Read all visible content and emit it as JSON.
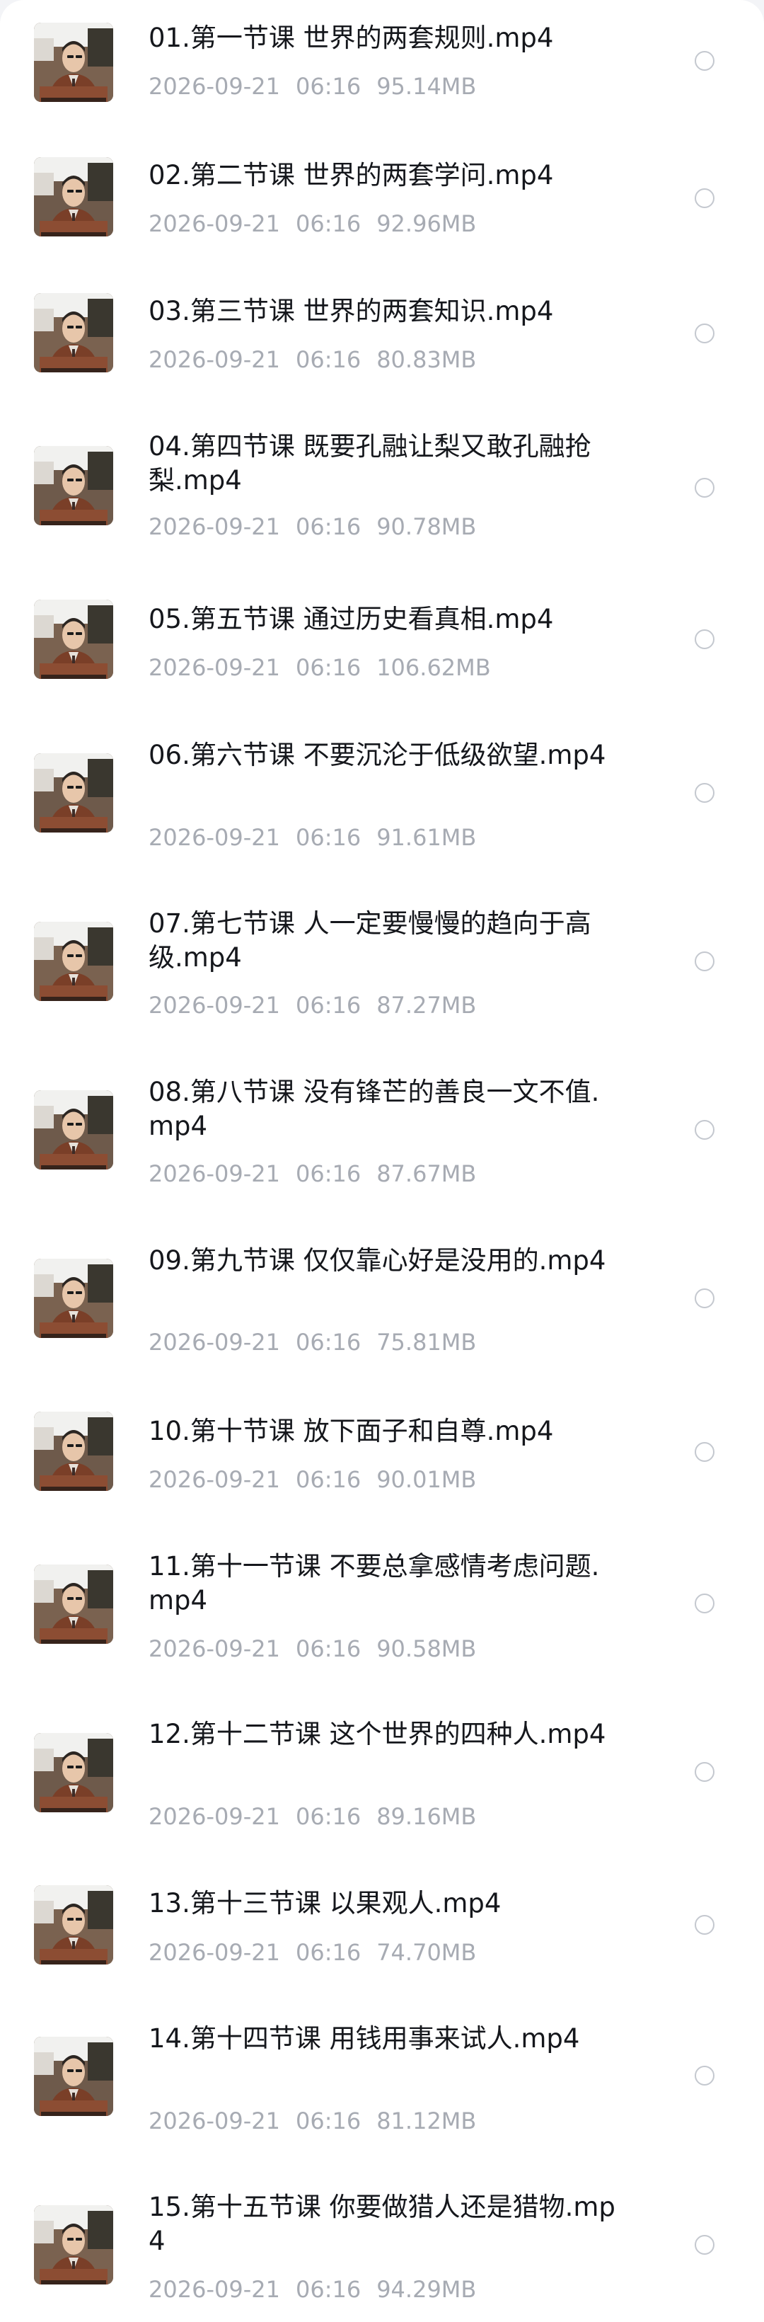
{
  "files": [
    {
      "title": "01.第一节课 世界的两套规则.mp4",
      "date": "2026-09-21",
      "time": "06:16",
      "size": "95.14MB"
    },
    {
      "title": "02.第二节课 世界的两套学问.mp4",
      "date": "2026-09-21",
      "time": "06:16",
      "size": "92.96MB"
    },
    {
      "title": "03.第三节课 世界的两套知识.mp4",
      "date": "2026-09-21",
      "time": "06:16",
      "size": "80.83MB"
    },
    {
      "title": "04.第四节课 既要孔融让梨又敢孔融抢梨.mp4",
      "date": "2026-09-21",
      "time": "06:16",
      "size": "90.78MB"
    },
    {
      "title": "05.第五节课  通过历史看真相.mp4",
      "date": "2026-09-21",
      "time": "06:16",
      "size": "106.62MB"
    },
    {
      "title": "06.第六节课  不要沉沦于低级欲望.mp4",
      "date": "2026-09-21",
      "time": "06:16",
      "size": "91.61MB"
    },
    {
      "title": "07.第七节课  人一定要慢慢的趋向于高级.mp4",
      "date": "2026-09-21",
      "time": "06:16",
      "size": "87.27MB"
    },
    {
      "title": "08.第八节课 没有锋芒的善良一文不值.mp4",
      "date": "2026-09-21",
      "time": "06:16",
      "size": "87.67MB"
    },
    {
      "title": "09.第九节课 仅仅靠心好是没用的.mp4",
      "date": "2026-09-21",
      "time": "06:16",
      "size": "75.81MB"
    },
    {
      "title": "10.第十节课 放下面子和自尊.mp4",
      "date": "2026-09-21",
      "time": "06:16",
      "size": "90.01MB"
    },
    {
      "title": "11.第十一节课  不要总拿感情考虑问题.mp4",
      "date": "2026-09-21",
      "time": "06:16",
      "size": "90.58MB"
    },
    {
      "title": "12.第十二节课 这个世界的四种人.mp4",
      "date": "2026-09-21",
      "time": "06:16",
      "size": "89.16MB"
    },
    {
      "title": "13.第十三节课  以果观人.mp4",
      "date": "2026-09-21",
      "time": "06:16",
      "size": "74.70MB"
    },
    {
      "title": "14.第十四节课 用钱用事来试人.mp4",
      "date": "2026-09-21",
      "time": "06:16",
      "size": "81.12MB"
    },
    {
      "title": "15.第十五节课 你要做猎人还是猎物.mp4",
      "date": "2026-09-21",
      "time": "06:16",
      "size": "94.29MB"
    }
  ],
  "colors": {
    "title": "#15171c",
    "meta": "#a7abb3",
    "radio": "#c4c8cf"
  },
  "icons": {
    "thumbnail": "video-thumbnail",
    "select": "radio-unselected-icon"
  }
}
